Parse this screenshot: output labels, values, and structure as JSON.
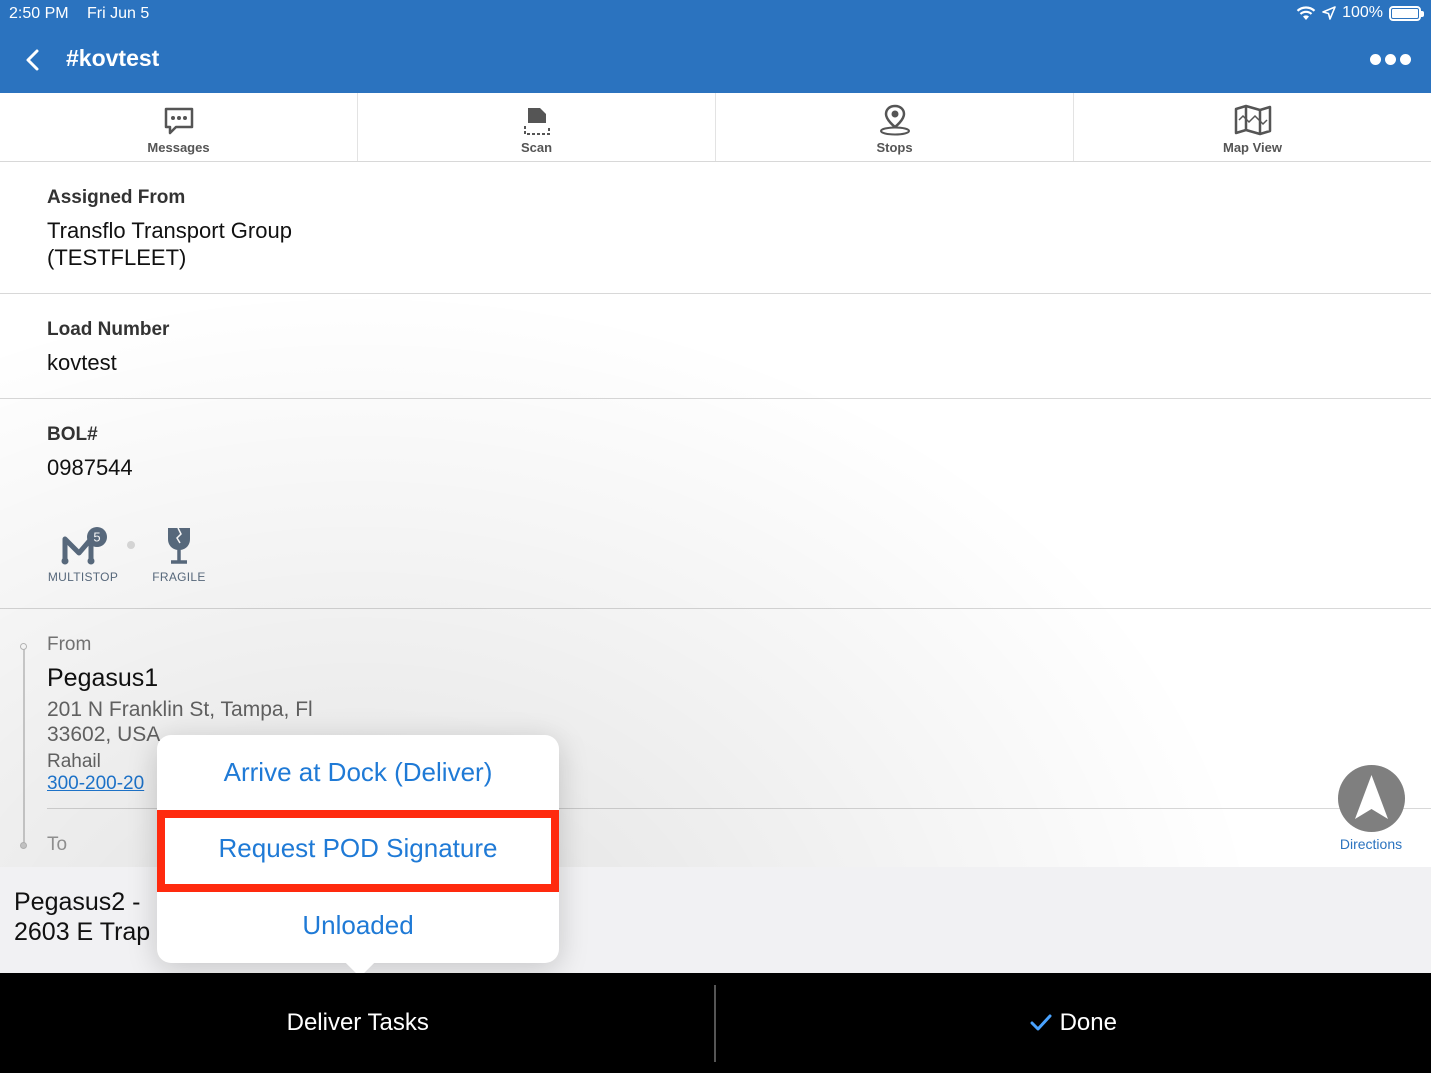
{
  "status_bar": {
    "time": "2:50 PM",
    "date": "Fri Jun 5",
    "battery": "100%"
  },
  "nav": {
    "title": "#kovtest",
    "back_icon": "chevron-left-icon",
    "more_icon": "ellipsis-icon"
  },
  "toolbar": {
    "items": [
      {
        "label": "Messages",
        "icon": "chat-bubble-icon"
      },
      {
        "label": "Scan",
        "icon": "scan-document-icon"
      },
      {
        "label": "Stops",
        "icon": "map-pin-icon"
      },
      {
        "label": "Map View",
        "icon": "folded-map-icon"
      }
    ]
  },
  "load": {
    "assigned_from_label": "Assigned From",
    "assigned_from_line1": "Transflo Transport Group",
    "assigned_from_line2": "(TESTFLEET)",
    "load_number_label": "Load Number",
    "load_number": "kovtest",
    "bol_label": "BOL#",
    "bol": "0987544",
    "badges": [
      {
        "label": "MULTISTOP",
        "count": "5",
        "icon": "multistop-icon"
      },
      {
        "label": "FRAGILE",
        "icon": "fragile-glass-icon"
      }
    ]
  },
  "route": {
    "from_label": "From",
    "from_name": "Pegasus1",
    "from_address_line1": "201 N Franklin St, Tampa, Fl",
    "from_address_line2": "33602, USA",
    "contact_name": "Rahail",
    "contact_phone": "300-200-20",
    "to_label": "To",
    "directions_label": "Directions"
  },
  "next_stop": {
    "title": "Pegasus2 -",
    "address": "2603 E Trap"
  },
  "popover": {
    "items": [
      "Arrive at Dock (Deliver)",
      "Request POD Signature",
      "Unloaded"
    ]
  },
  "bottom_bar": {
    "deliver_tasks": "Deliver Tasks",
    "done": "Done"
  },
  "colors": {
    "header": "#2b73bf",
    "link": "#1f7ad6",
    "highlight": "#ff2a0e"
  }
}
